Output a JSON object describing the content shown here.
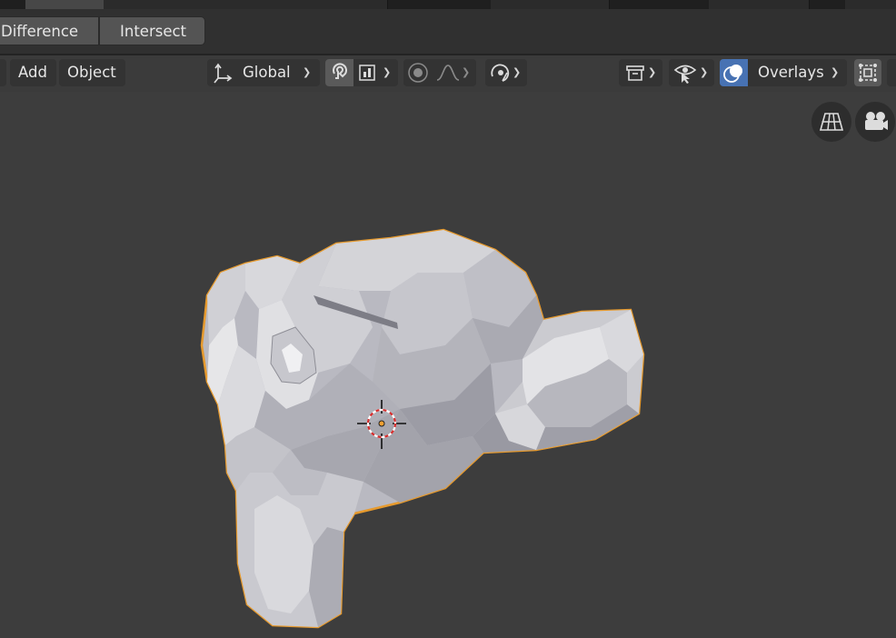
{
  "boolean_toolbar": {
    "difference_label": "Difference",
    "intersect_label": "Intersect"
  },
  "header": {
    "add_label": "Add",
    "object_label": "Object",
    "transform_orientation": "Global",
    "overlays_label": "Overlays"
  },
  "icons": {
    "transform_orientation": "axis-gizmo-icon",
    "snap": "magnet-icon",
    "snap_target": "snap-increment-icon",
    "proportional_edit": "proportional-edit-icon",
    "falloff": "falloff-curve-icon",
    "pivot": "orbit-pivot-icon",
    "visibility": "object-type-visibility-icon",
    "selectability": "view-selectable-icon",
    "overlays": "overlays-icon",
    "xray": "xray-toggle-icon",
    "grid_view": "perspective-grid-icon",
    "camera": "camera-view-icon",
    "cursor": "3d-cursor-icon"
  },
  "colors": {
    "selection_outline": "#e69a2e",
    "active_toggle": "#4772b3",
    "viewport_bg": "#3d3d3d"
  }
}
